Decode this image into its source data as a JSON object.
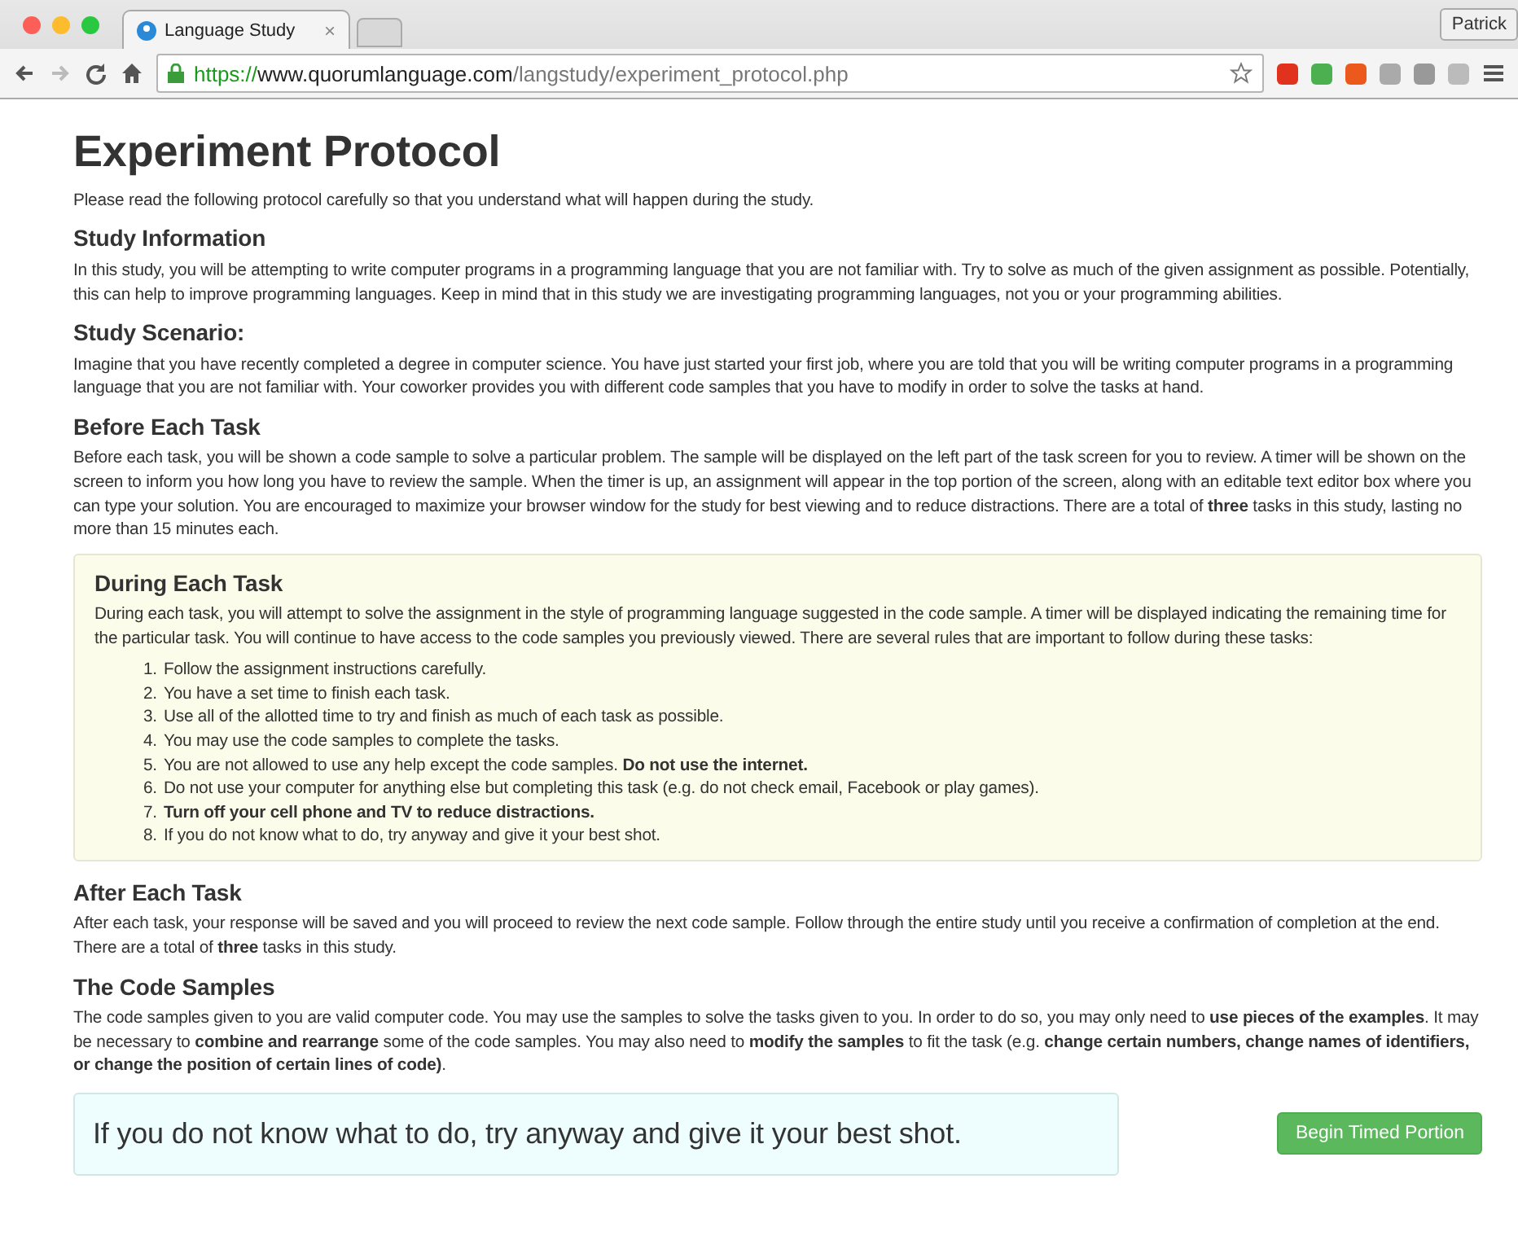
{
  "browser": {
    "tab": {
      "title": "Language Study",
      "close": "×",
      "selected": true
    },
    "profile": "Patrick",
    "url": {
      "scheme": "https://",
      "host": "www.quorumlanguage.com",
      "path": "/langstudy/experiment_protocol.php"
    }
  },
  "page": {
    "title": "Experiment Protocol",
    "intro": "Please read the following protocol carefully so that you understand what will happen during the study.",
    "sections": [
      {
        "kind": "plain",
        "heading": "Study Information",
        "text": "In this study, you will be attempting to write computer programs in a programming language that you are not familiar with. Try to solve as much of the given assignment as possible. Potentially, this can help to improve programming languages. Keep in mind that in this study we are investigating programming languages, not you or your programming abilities."
      },
      {
        "kind": "plain",
        "heading": "Study Scenario:",
        "text": "Imagine that you have recently completed a degree in computer science. You have just started your first job, where you are told that you will be writing computer programs in a programming language that you are not familiar with. Your coworker provides you with different code samples that you have to modify in order to solve the tasks at hand."
      },
      {
        "kind": "plain",
        "heading": "Before Each Task",
        "text": "Before each task, you will be shown a code sample to solve a particular problem. The sample will be displayed on the left part of the task screen for you to review. A timer will be shown on the screen to inform you how long you have to review the sample. When the timer is up, an assignment will appear in the top portion of the screen, along with an editable text editor box where you can type your solution. You are encouraged to maximize your browser window for the study for best viewing and to reduce distractions. There are a total of **three** tasks in this study, lasting no more than 15 minutes each."
      },
      {
        "kind": "callout",
        "heading": "During Each Task",
        "text": "During each task, you will attempt to solve the assignment in the style of programming language suggested in the code sample. A timer will be displayed indicating the remaining time for the particular task. You will continue to have access to the code samples you previously viewed. There are several rules that are important to follow during these tasks:",
        "rules": [
          {
            "number": "1.",
            "text": "Follow the assignment instructions carefully."
          },
          {
            "number": "2.",
            "text": "You have a set time to finish each task."
          },
          {
            "number": "3.",
            "text": "Use all of the allotted time to try and finish as much of each task as possible."
          },
          {
            "number": "4.",
            "text": "You may use the code samples to complete the tasks."
          },
          {
            "number": "5.",
            "text": "You are not allowed to use any help except the code samples. **Do not use the internet.**"
          },
          {
            "number": "6.",
            "text": "Do not use your computer for anything else but completing this task (e.g. do not check email, Facebook or play games)."
          },
          {
            "number": "7.",
            "text": "**Turn off your cell phone and TV to reduce distractions.**"
          },
          {
            "number": "8.",
            "text": "If you do not know what to do, try anyway and give it your best shot."
          }
        ]
      },
      {
        "kind": "plain",
        "heading": "After Each Task",
        "text": "After each task, your response will be saved and you will proceed to review the next code sample. Follow through the entire study until you receive a confirmation of completion at the end. There are a total of **three** tasks in this study."
      },
      {
        "kind": "plain",
        "heading": "The Code Samples",
        "text": "The code samples given to you are valid computer code. You may use the samples to solve the tasks given to you. In order to do so, you may only need to **use pieces of the examples**. It may be necessary to **combine and rearrange** some of the code samples. You may also need to **modify the samples** to fit the task (e.g. **change certain numbers, change names of identifiers, or change the position of certain lines of code)**."
      }
    ],
    "banner": "If you do not know what to do, try anyway and give it your best shot.",
    "button": "Begin Timed Portion"
  }
}
